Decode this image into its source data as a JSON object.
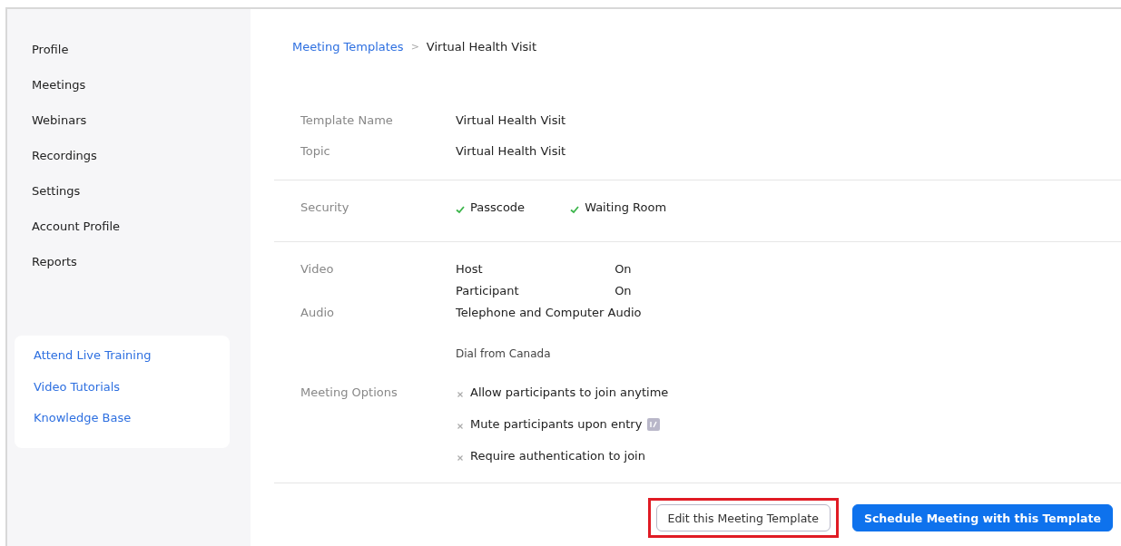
{
  "sidebar": {
    "nav": [
      {
        "label": "Profile"
      },
      {
        "label": "Meetings"
      },
      {
        "label": "Webinars"
      },
      {
        "label": "Recordings"
      },
      {
        "label": "Settings"
      },
      {
        "label": "Account Profile"
      },
      {
        "label": "Reports"
      }
    ],
    "links": [
      {
        "label": "Attend Live Training"
      },
      {
        "label": "Video Tutorials"
      },
      {
        "label": "Knowledge Base"
      }
    ]
  },
  "breadcrumb": {
    "parent": "Meeting Templates",
    "separator": ">",
    "current": "Virtual Health Visit"
  },
  "sections": [
    {
      "rows": [
        {
          "label": "Template Name",
          "kind": "text",
          "value": "Virtual Health Visit"
        },
        {
          "label": "Topic",
          "kind": "text",
          "value": "Virtual Health Visit"
        }
      ]
    },
    {
      "rows": [
        {
          "label": "Security",
          "kind": "checks",
          "items": [
            {
              "label": "Passcode",
              "enabled": true
            },
            {
              "label": "Waiting Room",
              "enabled": true
            }
          ]
        }
      ]
    },
    {
      "rows": [
        {
          "label": "Video",
          "kind": "pairs",
          "items": [
            {
              "name": "Host",
              "value": "On"
            },
            {
              "name": "Participant",
              "value": "On"
            }
          ]
        },
        {
          "label": "Audio",
          "kind": "text",
          "value": "Telephone and Computer Audio"
        },
        {
          "kind": "note",
          "value": "Dial from Canada"
        },
        {
          "label": "Meeting Options",
          "kind": "options",
          "items": [
            {
              "label": "Allow participants to join anytime",
              "enabled": false,
              "info_icon": false
            },
            {
              "label": "Mute participants upon entry",
              "enabled": false,
              "info_icon": true
            },
            {
              "label": "Require authentication to join",
              "enabled": false,
              "info_icon": false
            }
          ]
        }
      ]
    }
  ],
  "actions": [
    {
      "label": "Edit this Meeting Template",
      "kind": "secondary",
      "highlighted": true
    },
    {
      "label": "Schedule Meeting with this Template",
      "kind": "primary",
      "highlighted": false
    }
  ]
}
